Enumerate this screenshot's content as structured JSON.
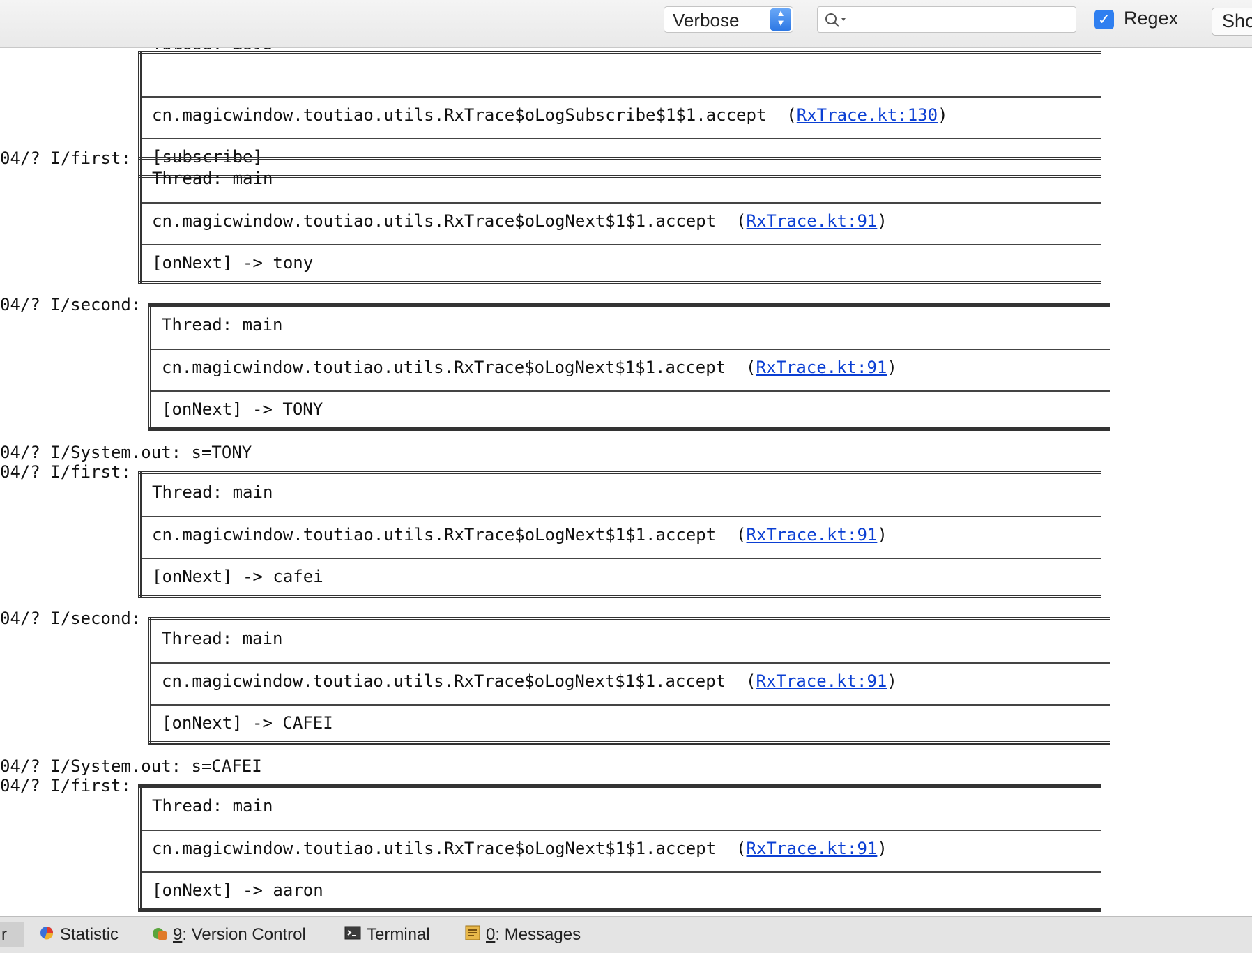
{
  "toolbar": {
    "level": "Verbose",
    "search_value": "",
    "regex_label": "Regex",
    "regex_checked": true,
    "show_label": "Sho"
  },
  "log": {
    "partial_top": "Thread: main",
    "entries": [
      {
        "prefix": "",
        "box": "first",
        "thread": "",
        "method": "cn.magicwindow.toutiao.utils.RxTrace$oLogSubscribe$1$1.accept",
        "source": "RxTrace.kt:130",
        "message": "[subscribe]"
      },
      {
        "prefix": "04/? I/first:",
        "box": "first",
        "thread": "Thread: main",
        "method": "cn.magicwindow.toutiao.utils.RxTrace$oLogNext$1$1.accept",
        "source": "RxTrace.kt:91",
        "message": "[onNext] -> tony"
      },
      {
        "prefix": "04/? I/second:",
        "box": "second",
        "thread": "Thread: main",
        "method": "cn.magicwindow.toutiao.utils.RxTrace$oLogNext$1$1.accept",
        "source": "RxTrace.kt:91",
        "message": "[onNext] -> TONY"
      },
      {
        "prefix": "04/? I/System.out: s=TONY",
        "plain": true
      },
      {
        "prefix": "04/? I/first:",
        "box": "first",
        "thread": "Thread: main",
        "method": "cn.magicwindow.toutiao.utils.RxTrace$oLogNext$1$1.accept",
        "source": "RxTrace.kt:91",
        "message": "[onNext] -> cafei"
      },
      {
        "prefix": "04/? I/second:",
        "box": "second",
        "thread": "Thread: main",
        "method": "cn.magicwindow.toutiao.utils.RxTrace$oLogNext$1$1.accept",
        "source": "RxTrace.kt:91",
        "message": "[onNext] -> CAFEI"
      },
      {
        "prefix": "04/? I/System.out: s=CAFEI",
        "plain": true
      },
      {
        "prefix": "04/? I/first:",
        "box": "first",
        "thread": "Thread: main",
        "method": "cn.magicwindow.toutiao.utils.RxTrace$oLogNext$1$1.accept",
        "source": "RxTrace.kt:91",
        "message": "[onNext] -> aaron"
      }
    ]
  },
  "bottom_tabs": [
    {
      "mnemonic": "",
      "label": "Statistic",
      "icon": "statistic-icon"
    },
    {
      "mnemonic": "9",
      "label": ": Version Control",
      "icon": "version-control-icon"
    },
    {
      "mnemonic": "",
      "label": "Terminal",
      "icon": "terminal-icon"
    },
    {
      "mnemonic": "0",
      "label": ": Messages",
      "icon": "messages-icon"
    }
  ],
  "bottom_first_tab": "r"
}
